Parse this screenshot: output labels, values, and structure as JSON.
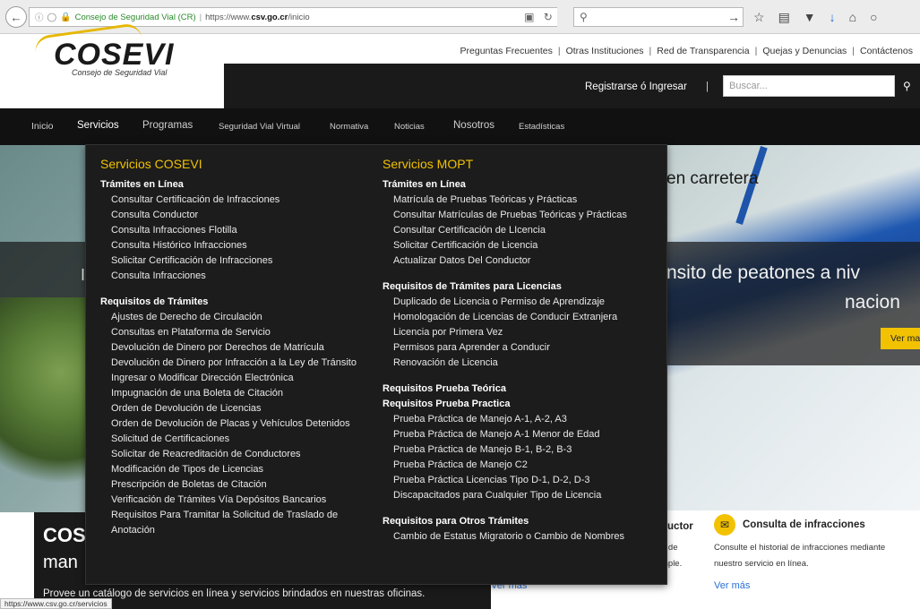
{
  "browser": {
    "security_label": "Consejo de Seguridad Vial (CR)",
    "url_prefix": "https://www.",
    "url_host": "csv.go.cr",
    "url_path": "/inicio",
    "search_placeholder": ""
  },
  "top_links": [
    "Preguntas Frecuentes",
    "Otras Instituciones",
    "Red de Transparencia",
    "Quejas y Denuncias",
    "Contáctenos"
  ],
  "header": {
    "logo_text": "COSEVI",
    "logo_sub": "Consejo de Seguridad Vial",
    "register": "Registrarse ó Ingresar",
    "search_placeholder": "Buscar..."
  },
  "nav": [
    "Inicio",
    "Servicios",
    "Programas",
    "Seguridad Vial Virtual",
    "Normativa",
    "Noticias",
    "Nosotros",
    "Estadísticas"
  ],
  "dropdown": {
    "left": {
      "title": "Servicios COSEVI",
      "sections": [
        {
          "heading": "Trámites en Línea",
          "items": [
            "Consultar Certificación de Infracciones",
            "Consulta Conductor",
            "Consulta Infracciones Flotilla",
            "Consulta Histórico Infracciones",
            "Solicitar Certificación de Infracciones",
            "Consulta Infracciones"
          ]
        },
        {
          "heading": "Requisitos de Trámites",
          "items": [
            "Ajustes de Derecho de Circulación",
            "Consultas en Plataforma de Servicio",
            "Devolución de Dinero por Derechos de Matrícula",
            "Devolución de Dinero por Infracción a la Ley de Tránsito",
            "Ingresar o Modificar Dirección Electrónica",
            "Impugnación de una Boleta de Citación",
            "Orden de Devolución de Licencias",
            "Orden de Devolución de Placas y Vehículos Detenidos",
            "Solicitud de Certificaciones",
            "Solicitar de Reacreditación de Conductores",
            "Modificación de Tipos de Licencias",
            "Prescripción de Boletas de Citación",
            "Verificación de Trámites Vía Depósitos Bancarios",
            "Requisitos Para Tramitar la Solicitud de Traslado de Anotación"
          ]
        }
      ]
    },
    "right": {
      "title": "Servicios MOPT",
      "sections": [
        {
          "heading": "Trámites en Línea",
          "items": [
            "Matrícula de Pruebas Teóricas y Prácticas",
            "Consultar Matrículas de Pruebas Teóricas y Prácticas",
            "Consultar Certificación de LIcencia",
            "Solicitar Certificación de Licencia",
            "Actualizar Datos Del Conductor"
          ]
        },
        {
          "heading": "Requisitos de Trámites para Licencias",
          "items": [
            "Duplicado de Licencia o Permiso de Aprendizaje",
            "Homologación de Licencias de Conducir Extranjera",
            "Licencia por Primera Vez",
            "Permisos para Aprender a Conducir",
            "Renovación de Licencia"
          ]
        },
        {
          "heading": "Requisitos Prueba Teórica",
          "items": []
        },
        {
          "heading": "Requisitos Prueba Practica",
          "items": [
            "Prueba Práctica de Manejo A-1, A-2, A3",
            "Prueba Práctica de Manejo A-1 Menor de Edad",
            "Prueba Práctica de Manejo B-1, B-2, B-3",
            "Prueba Práctica de Manejo C2",
            "Prueba Práctica Licencias Tipo D-1, D-2, D-3",
            "Discapacitados para Cualquier Tipo de Licencia"
          ]
        },
        {
          "heading": "Requisitos para Otros Trámites",
          "items": [
            "Cambio de Estatus Migratorio o Cambio de Nombres"
          ]
        }
      ]
    }
  },
  "hero": {
    "line1": "en carretera",
    "line2": "nsito de peatones a niv",
    "line3": "nacion",
    "button": "Ver ma",
    "left_frag": "I"
  },
  "bottom": {
    "title": "COS",
    "subtitle": "man",
    "desc": "Provee un catálogo de servicios en línea y servicios brindados en nuestras oficinas."
  },
  "cards": {
    "c1_title": "ductor",
    "c1_line1": "e de",
    "c1_line2": "mple.",
    "c1_link": "Ver más",
    "c2_title": "Consulta de infracciones",
    "c2_desc1": "Consulte el historial de infracciones mediante",
    "c2_desc2": "nuestro servicio en línea.",
    "c2_link": "Ver más"
  },
  "status_url": "https://www.csv.go.cr/servicios"
}
